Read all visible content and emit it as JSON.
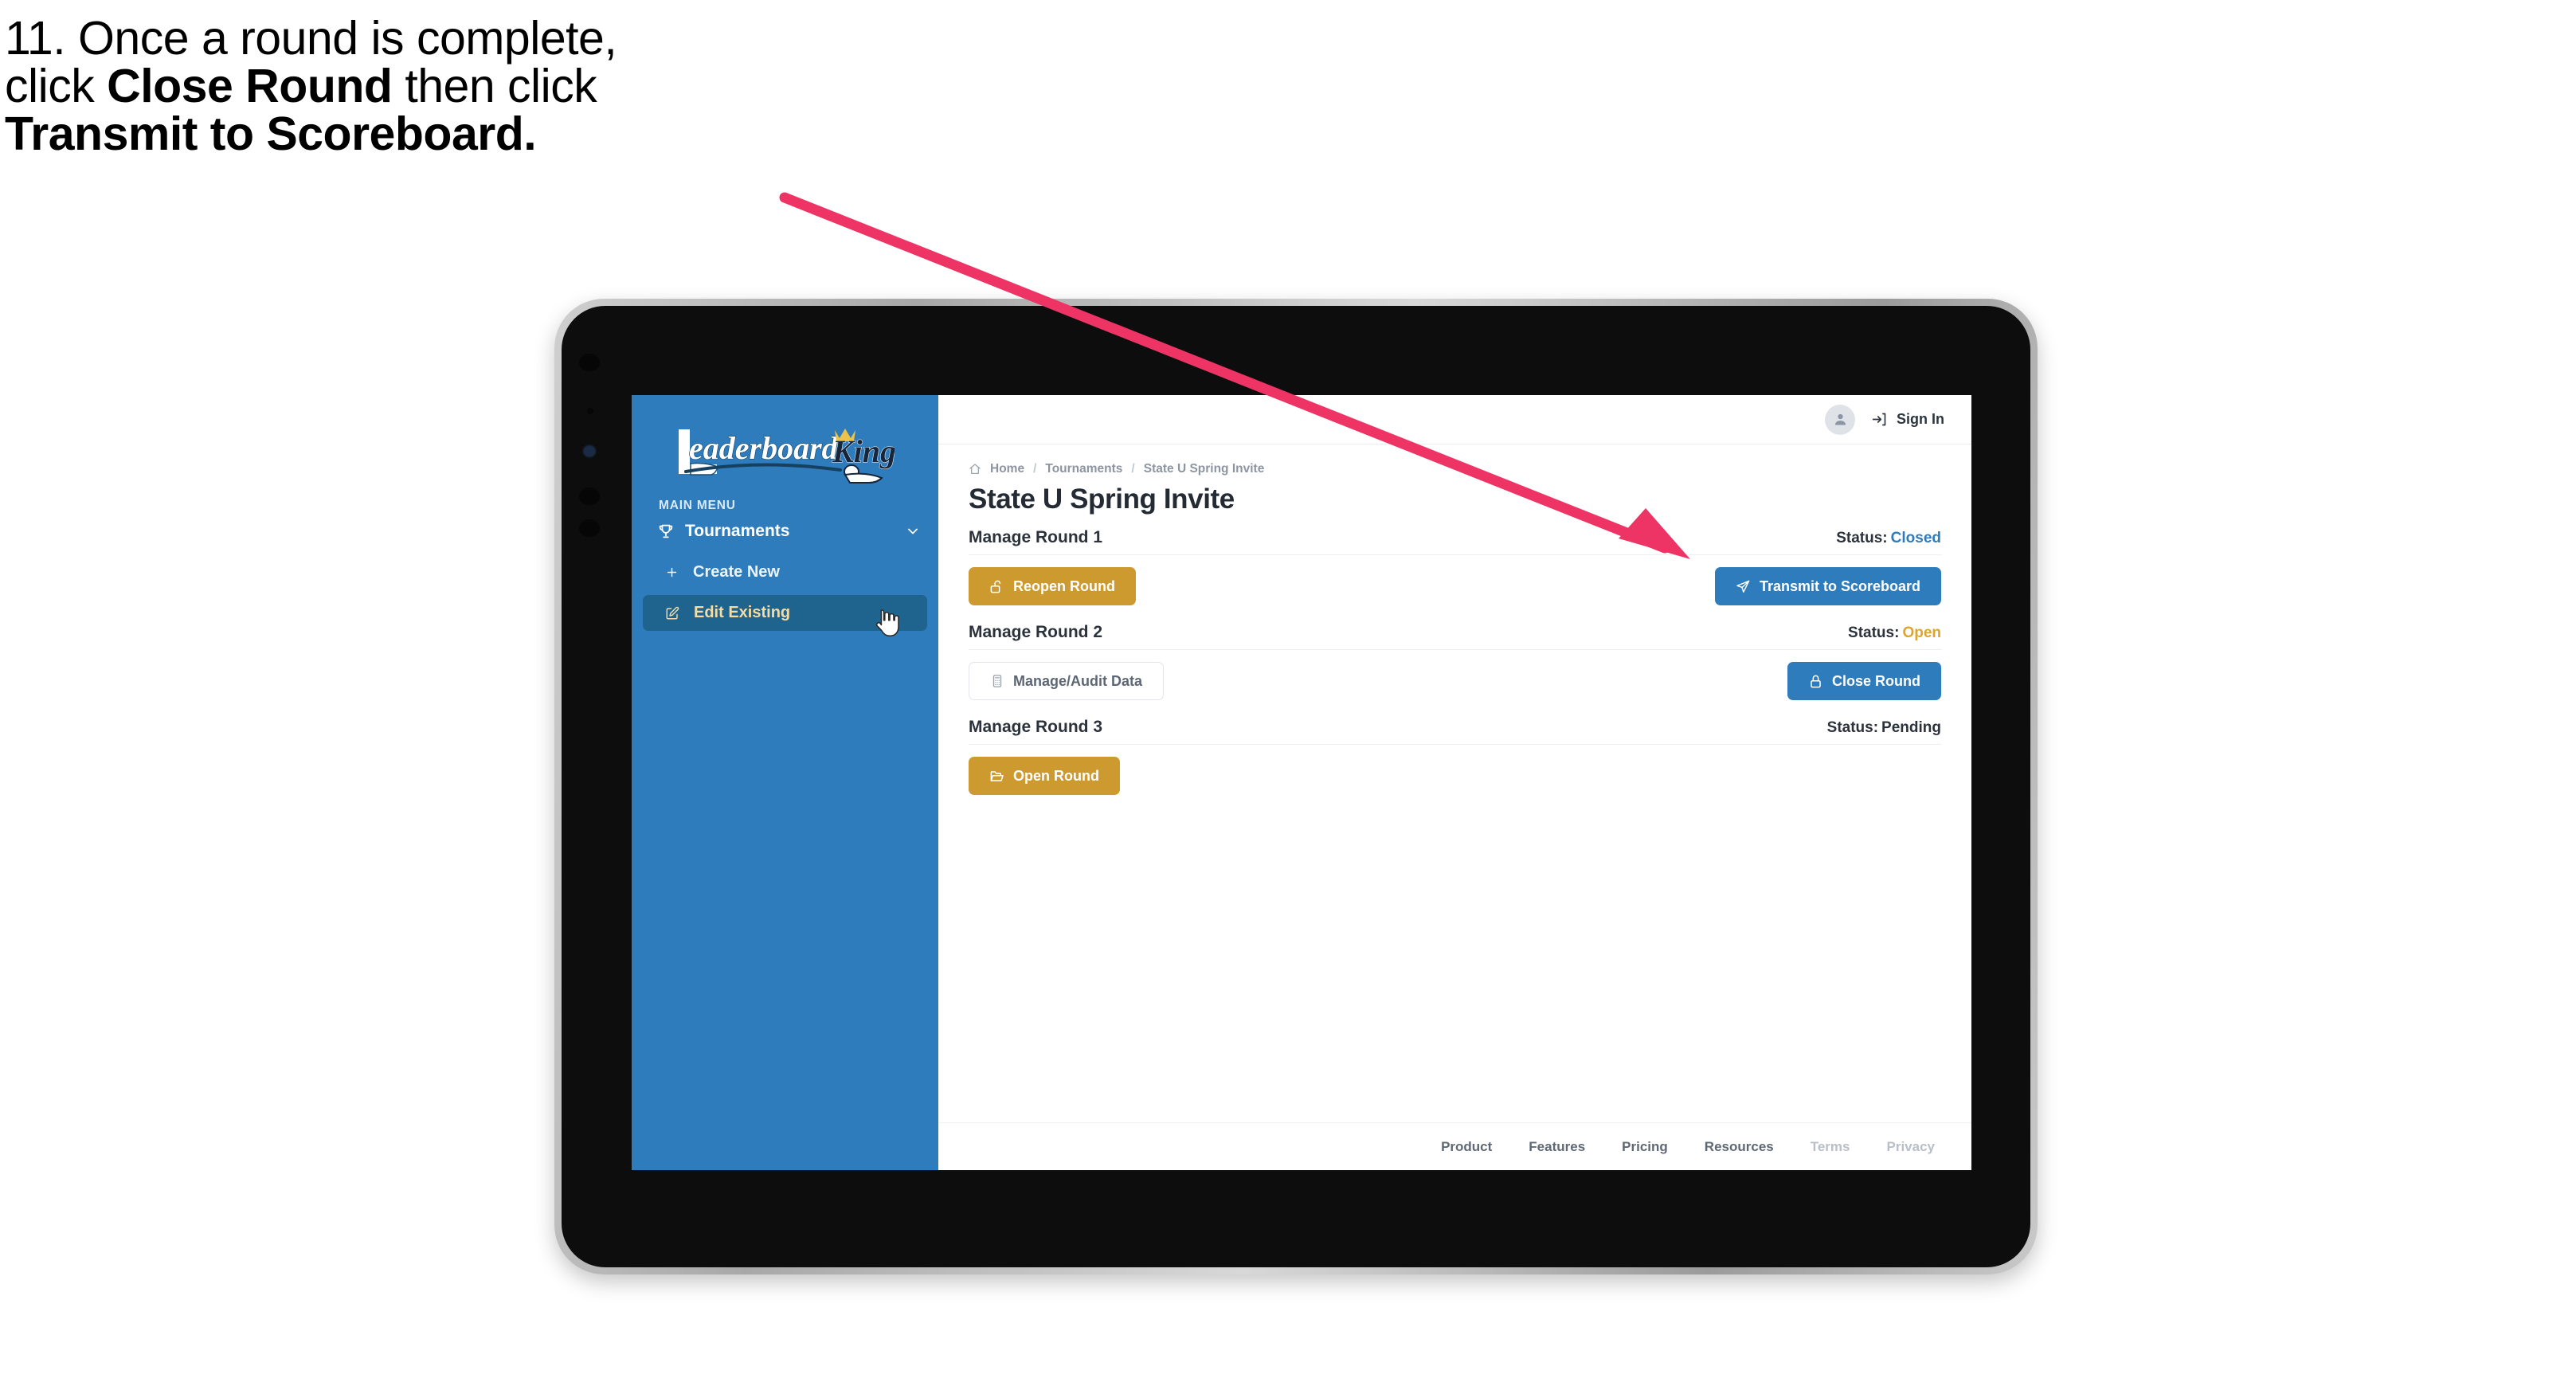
{
  "caption": {
    "line1": "11. Once a round is complete,",
    "line2_pre": "click ",
    "line2_bold": "Close Round",
    "line2_post": " then click",
    "line3_bold": "Transmit to Scoreboard."
  },
  "colors": {
    "sidebar_blue": "#2F7CBD",
    "sidebar_active": "#1F648F",
    "sidebar_active_text": "#F3DCA6",
    "gold": "#CC9A2E",
    "blue": "#2F7CBD",
    "status_open": "#E0A42B",
    "status_closed": "#2F7CBD",
    "status_pending": "#2B323C",
    "arrow_pink": "#EE3465",
    "bezel_silver": "#C4C4C4",
    "device_black": "#0D0D0D"
  },
  "sidebar": {
    "logo_primary": "Leaderboard",
    "logo_secondary": "King",
    "menu_label": "MAIN MENU",
    "items": [
      {
        "label": "Tournaments",
        "icon": "trophy-icon",
        "chevron": "chevron-down-icon",
        "active": false
      },
      {
        "label": "Create New",
        "icon": "plus-icon",
        "active": false
      },
      {
        "label": "Edit Existing",
        "icon": "edit-pencil-icon",
        "active": true
      }
    ]
  },
  "topbar": {
    "avatar_icon": "user-avatar-icon",
    "signin_icon": "login-arrow-icon",
    "signin_label": "Sign In"
  },
  "breadcrumb": {
    "home_icon": "home-icon",
    "items": [
      "Home",
      "Tournaments",
      "State U Spring Invite"
    ],
    "separator": "/"
  },
  "page": {
    "title": "State U Spring Invite",
    "status_prefix": "Status:"
  },
  "rounds": [
    {
      "name": "Manage Round 1",
      "status_label": "Status:",
      "status_value": "Closed",
      "status_class": "closed",
      "left_button": {
        "label": "Reopen Round",
        "style": "gold",
        "icon": "unlock-icon"
      },
      "right_button": {
        "label": "Transmit to Scoreboard",
        "style": "blue",
        "icon": "paper-plane-icon"
      }
    },
    {
      "name": "Manage Round 2",
      "status_label": "Status:",
      "status_value": "Open",
      "status_class": "open",
      "left_button": {
        "label": "Manage/Audit Data",
        "style": "ghost",
        "icon": "calculator-icon"
      },
      "right_button": {
        "label": "Close Round",
        "style": "blue",
        "icon": "lock-icon"
      }
    },
    {
      "name": "Manage Round 3",
      "status_label": "Status:",
      "status_value": "Pending",
      "status_class": "pending",
      "left_button": {
        "label": "Open Round",
        "style": "gold",
        "icon": "folder-open-icon"
      },
      "right_button": null
    }
  ],
  "footer": {
    "links": [
      {
        "label": "Product",
        "muted": false
      },
      {
        "label": "Features",
        "muted": false
      },
      {
        "label": "Pricing",
        "muted": false
      },
      {
        "label": "Resources",
        "muted": false
      },
      {
        "label": "Terms",
        "muted": true
      },
      {
        "label": "Privacy",
        "muted": true
      }
    ]
  },
  "cursor": {
    "icon": "pointing-hand-cursor"
  },
  "annotation": {
    "icon": "arrow-pointer",
    "points_to": "Transmit to Scoreboard"
  }
}
